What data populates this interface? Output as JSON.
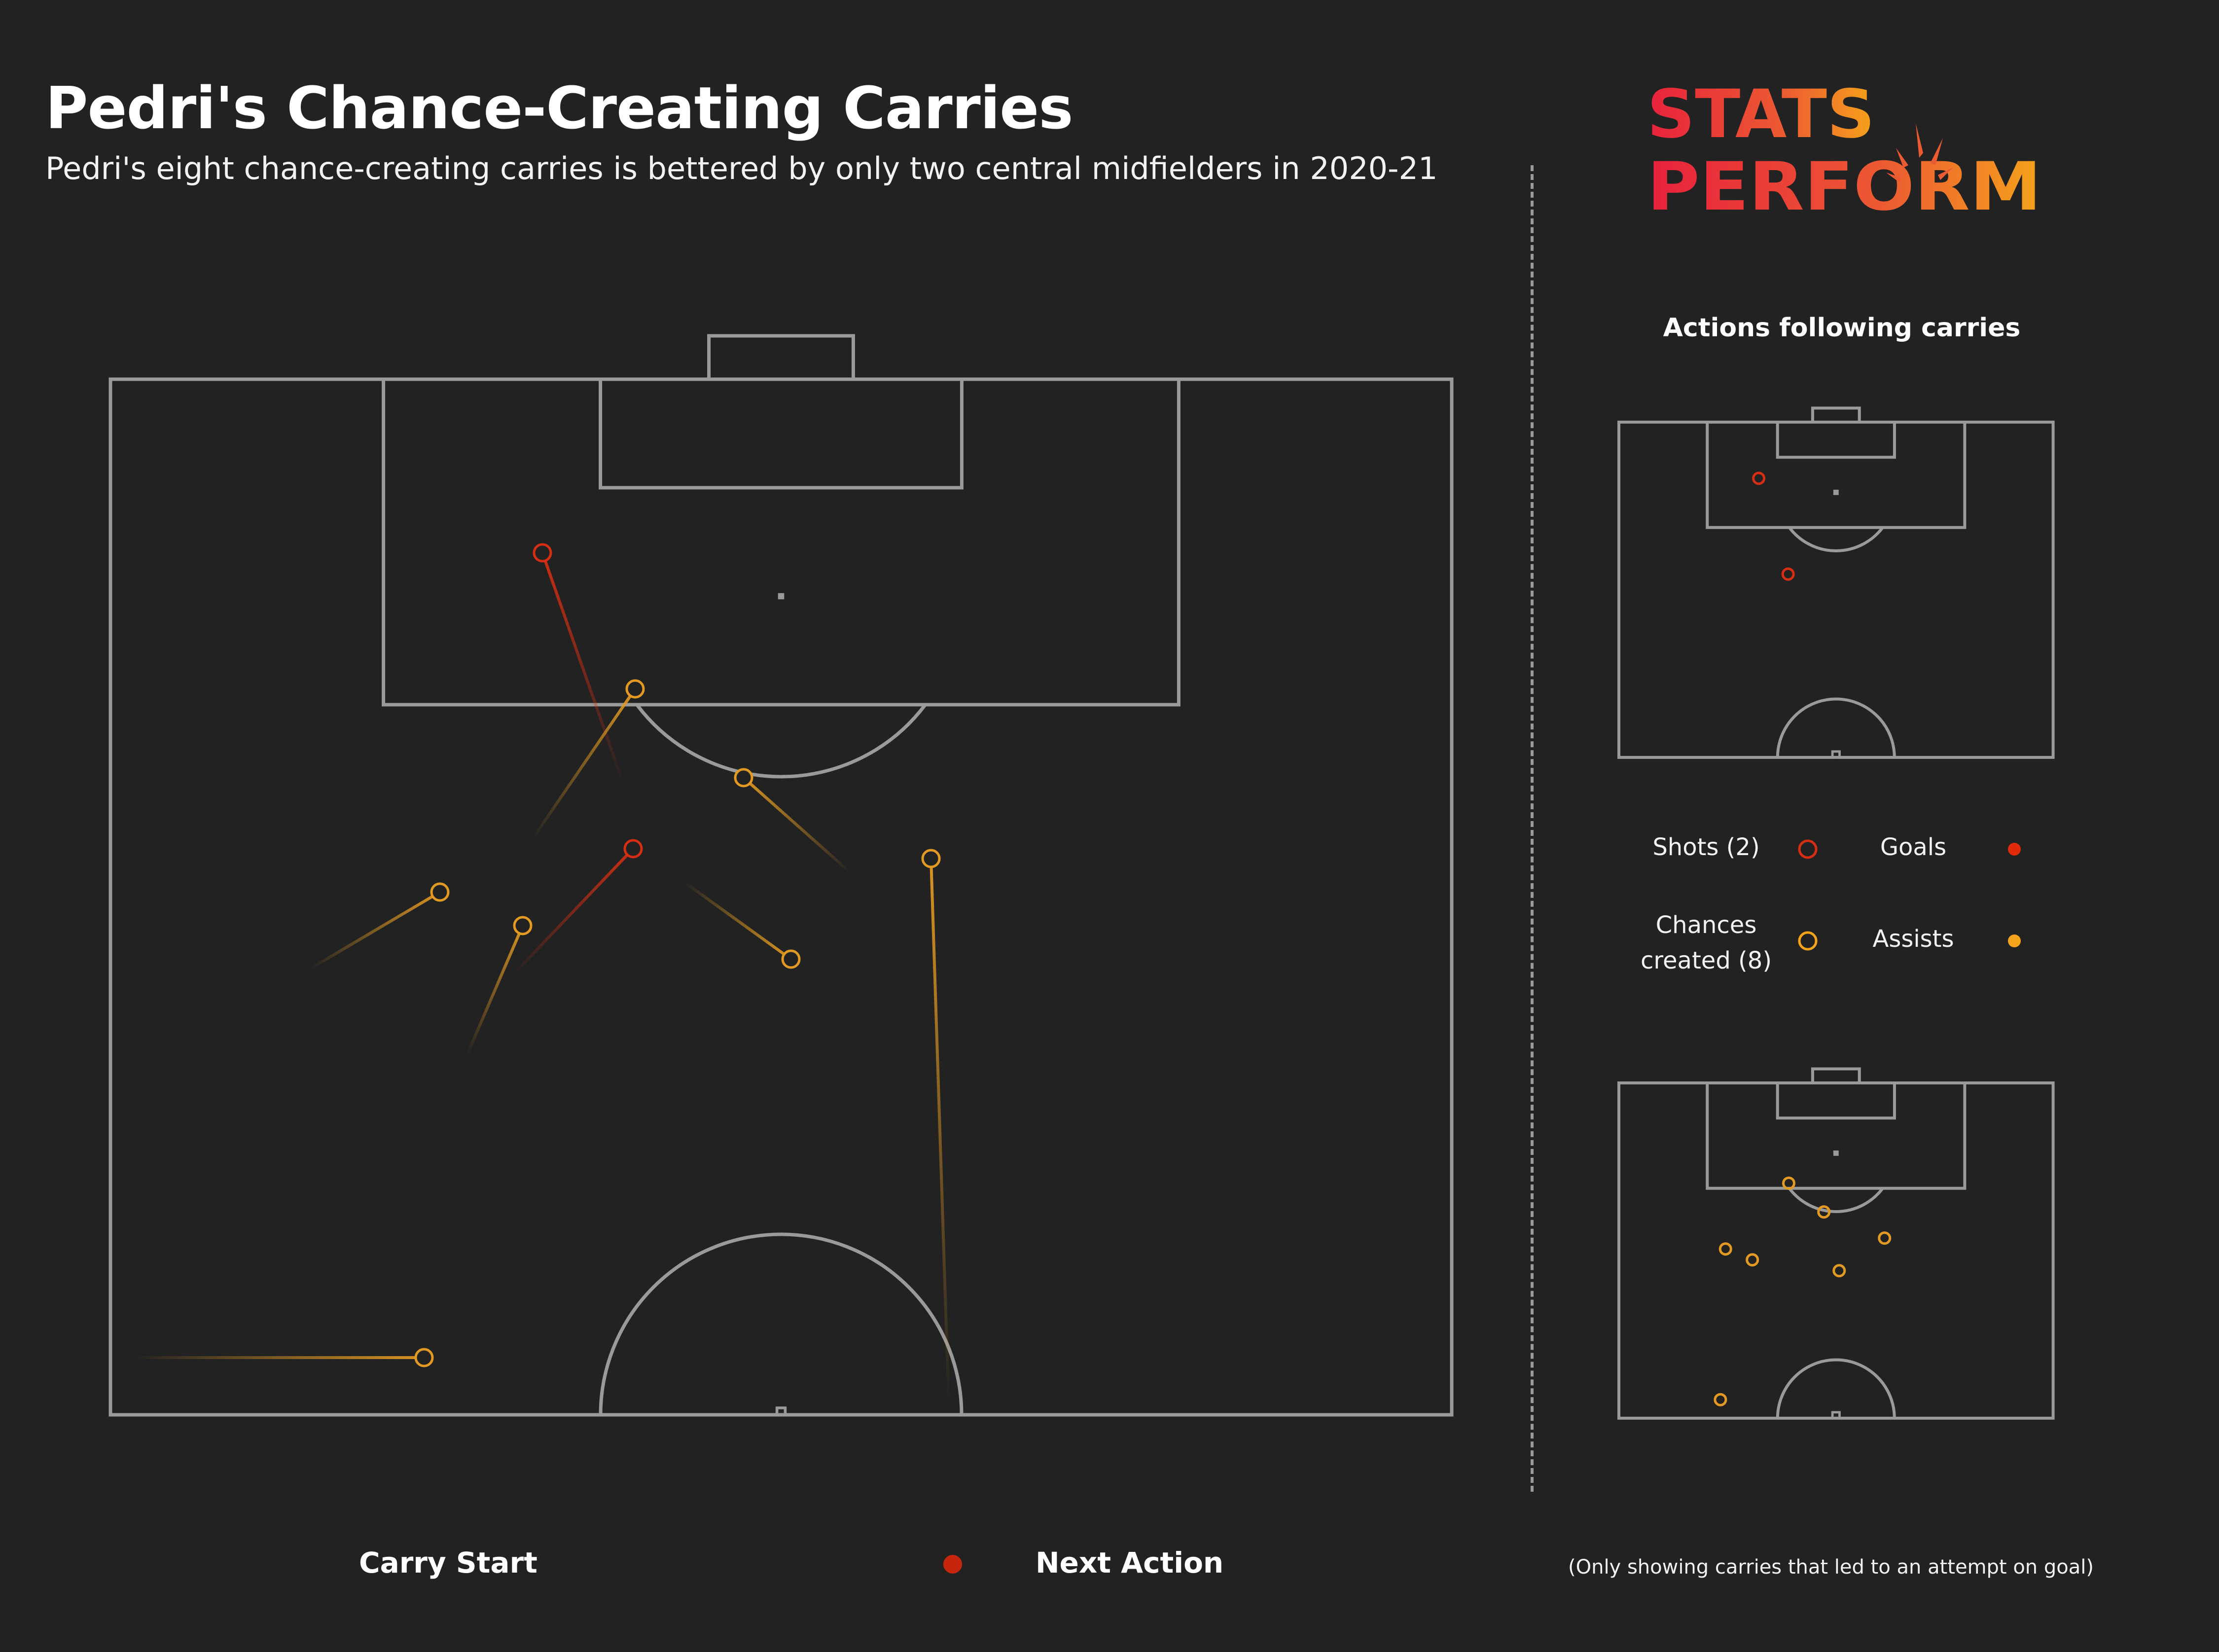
{
  "header": {
    "title": "Pedri's Chance-Creating Carries",
    "subtitle": "Pedri's eight chance-creating carries is bettered by only two central midfielders in 2020-21"
  },
  "logo": {
    "line1": "STATS",
    "line2": "PERF",
    "line2_o": "O",
    "line2_end": "RM",
    "gradient_start": "#e8213c",
    "gradient_end": "#f5a31a"
  },
  "side_panel": {
    "heading": "Actions following carries",
    "legend": [
      {
        "label": "Shots (2)",
        "marker": "open-circle",
        "color": "#d62e12"
      },
      {
        "label": "Goals",
        "marker": "filled-circle",
        "color": "#e02a0a"
      },
      {
        "label_line1": "Chances",
        "label_line2": "created (8)",
        "marker": "open-circle",
        "color": "#f5a31a"
      },
      {
        "label": "Assists",
        "marker": "filled-circle",
        "color": "#f5a31a"
      }
    ],
    "footnote": "(Only showing carries that led to an attempt on goal)"
  },
  "bottom_legend": {
    "start_label": "Carry Start",
    "end_label": "Next Action",
    "color": "#c8260c"
  },
  "colors": {
    "background": "#222222",
    "pitch_lines": "#9a9a9a",
    "shot": "#d62e12",
    "chance": "#e39a22"
  },
  "chart_data": {
    "type": "scatter",
    "title": "Pedri's Chance-Creating Carries",
    "subtitle": "Pedri's eight chance-creating carries is bettered by only two central midfielders in 2020-21",
    "pitch": {
      "width_m": 68,
      "half_length_m": 52.5,
      "orientation": "attacking-top"
    },
    "units": "metres from top-left corner of attacking half (x across, y down from goal line)",
    "carries": [
      {
        "outcome": "shot",
        "start": [
          26.0,
          20.5
        ],
        "end": [
          21.9,
          8.8
        ]
      },
      {
        "outcome": "chance",
        "start": [
          21.4,
          23.3
        ],
        "end": [
          26.6,
          15.7
        ]
      },
      {
        "outcome": "chance",
        "start": [
          37.5,
          25.0
        ],
        "end": [
          32.1,
          20.2
        ]
      },
      {
        "outcome": "shot",
        "start": [
          20.4,
          30.2
        ],
        "end": [
          26.5,
          23.8
        ]
      },
      {
        "outcome": "chance",
        "start": [
          42.5,
          51.9
        ],
        "end": [
          41.6,
          24.3
        ]
      },
      {
        "outcome": "chance",
        "start": [
          10.1,
          29.9
        ],
        "end": [
          16.7,
          26.0
        ]
      },
      {
        "outcome": "chance",
        "start": [
          18.1,
          34.2
        ],
        "end": [
          20.9,
          27.7
        ]
      },
      {
        "outcome": "chance",
        "start": [
          29.1,
          25.5
        ],
        "end": [
          34.5,
          29.4
        ]
      },
      {
        "outcome": "chance",
        "start": [
          1.2,
          49.6
        ],
        "end": [
          15.9,
          49.6
        ]
      }
    ],
    "small_pitch_shots": [
      [
        21.9,
        8.8
      ],
      [
        26.5,
        23.8
      ]
    ],
    "small_pitch_chances": [
      [
        26.6,
        15.7
      ],
      [
        32.1,
        20.2
      ],
      [
        41.6,
        24.3
      ],
      [
        16.7,
        26.0
      ],
      [
        20.9,
        27.7
      ],
      [
        34.5,
        29.4
      ],
      [
        15.9,
        49.6
      ]
    ],
    "legend": [
      "Shots (2)",
      "Goals",
      "Chances created (8)",
      "Assists"
    ]
  }
}
